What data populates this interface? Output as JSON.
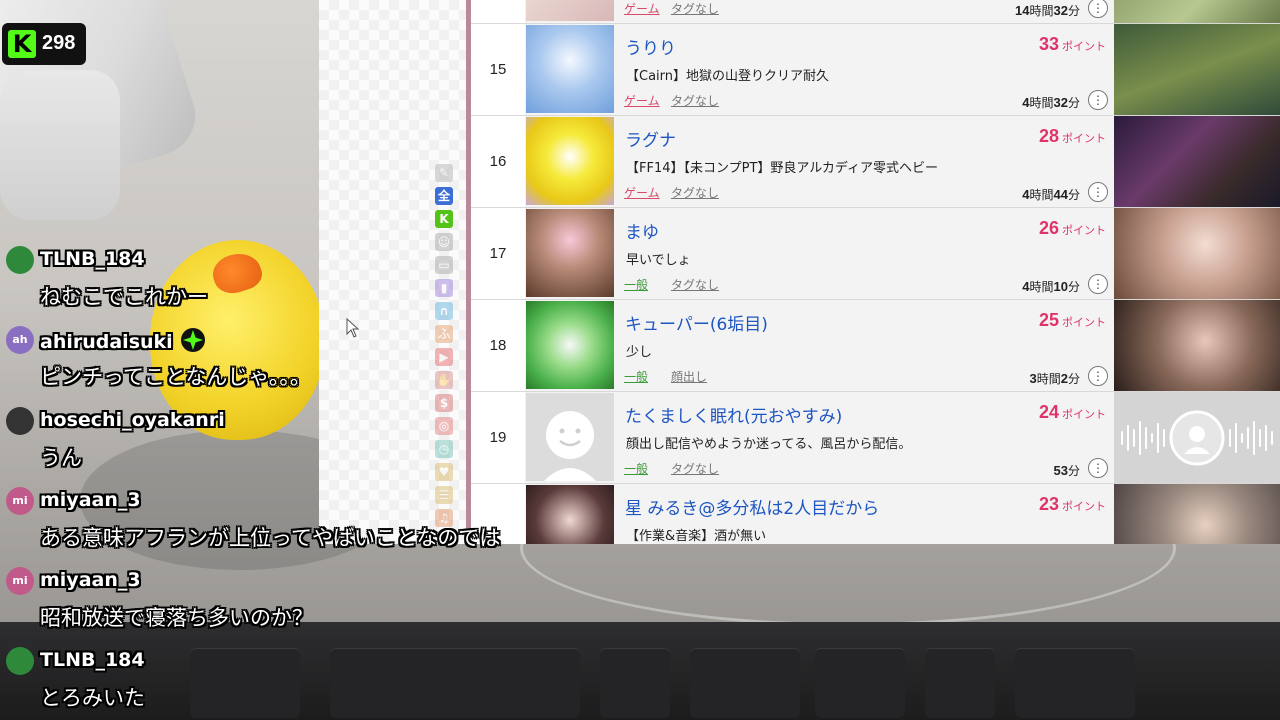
{
  "viewer_badge": {
    "logo": "K",
    "count": "298"
  },
  "ranking": [
    {
      "rank": "",
      "name": "",
      "points": "",
      "unit": "",
      "title": "",
      "category": "ゲーム",
      "category_color": "#d84a6a",
      "tags": "タグなし",
      "duration_h": "14",
      "duration_m": "32",
      "h_unit": "時間",
      "m_unit": "分"
    },
    {
      "rank": "15",
      "name": "うりり",
      "points": "33",
      "unit": "ポイント",
      "title": "【Cairn】地獄の山登りクリア耐久",
      "category": "ゲーム",
      "category_color": "#d84a6a",
      "tags": "タグなし",
      "duration_h": "4",
      "duration_m": "32",
      "h_unit": "時間",
      "m_unit": "分"
    },
    {
      "rank": "16",
      "name": "ラグナ",
      "points": "28",
      "unit": "ポイント",
      "title": "【FF14】【未コンプPT】野良アルカディア零式ヘビー",
      "category": "ゲーム",
      "category_color": "#d84a6a",
      "tags": "タグなし",
      "duration_h": "4",
      "duration_m": "44",
      "h_unit": "時間",
      "m_unit": "分"
    },
    {
      "rank": "17",
      "name": "まゆ",
      "points": "26",
      "unit": "ポイント",
      "title": "早いでしょ",
      "category": "一般",
      "category_color": "#3a9b3a",
      "tags": "タグなし",
      "duration_h": "4",
      "duration_m": "10",
      "h_unit": "時間",
      "m_unit": "分"
    },
    {
      "rank": "18",
      "name": "キューパー(6垢目)",
      "points": "25",
      "unit": "ポイント",
      "title": "少し",
      "category": "一般",
      "category_color": "#3a9b3a",
      "tags": "顔出し",
      "duration_h": "3",
      "duration_m": "2",
      "h_unit": "時間",
      "m_unit": "分"
    },
    {
      "rank": "19",
      "name": "たくましく眠れ(元おやすみ)",
      "points": "24",
      "unit": "ポイント",
      "title": "顔出し配信やめようか迷ってる、風呂から配信。",
      "category": "一般",
      "category_color": "#3a9b3a",
      "tags": "タグなし",
      "duration_h": "",
      "duration_m": "53",
      "h_unit": "",
      "m_unit": "分"
    },
    {
      "rank": "",
      "name": "星 みるき@多分私は2人目だから",
      "points": "23",
      "unit": "ポイント",
      "title": "【作業&音楽】酒が無い",
      "category": "",
      "category_color": "#3a9b3a",
      "tags": "",
      "duration_h": "",
      "duration_m": "",
      "h_unit": "",
      "m_unit": ""
    }
  ],
  "sidebar_icons": [
    "edit-icon",
    "all-icon",
    "kick-icon",
    "person-icon",
    "tv-icon",
    "twitch-icon",
    "headset-icon",
    "fire-icon",
    "youtube-icon",
    "hand-icon",
    "dollar-icon",
    "target-icon",
    "clock-icon",
    "pin-icon",
    "bars-icon",
    "music-icon"
  ],
  "sidebar_all_label": "全",
  "chat": [
    {
      "user": "TLNB_184",
      "avatar": "",
      "avatar_color": "#2e8a3a",
      "text": "ねむこでこれかー"
    },
    {
      "user": "ahirudaisuki",
      "avatar": "ah",
      "avatar_color": "#8a6ec2",
      "text": "ピンチってことなんじゃ。。。"
    },
    {
      "user": "hosechi_oyakanri",
      "avatar": "",
      "avatar_color": "#333333",
      "text": "うん"
    },
    {
      "user": "miyaan_3",
      "avatar": "mi",
      "avatar_color": "#c05a8a",
      "text": "ある意味アフランが上位ってやばいことなのでは"
    },
    {
      "user": "miyaan_3",
      "avatar": "mi",
      "avatar_color": "#c05a8a",
      "text": "昭和放送で寝落ち多いのか？"
    },
    {
      "user": "TLNB_184",
      "avatar": "",
      "avatar_color": "#2e8a3a",
      "text": "とろみいた"
    }
  ]
}
